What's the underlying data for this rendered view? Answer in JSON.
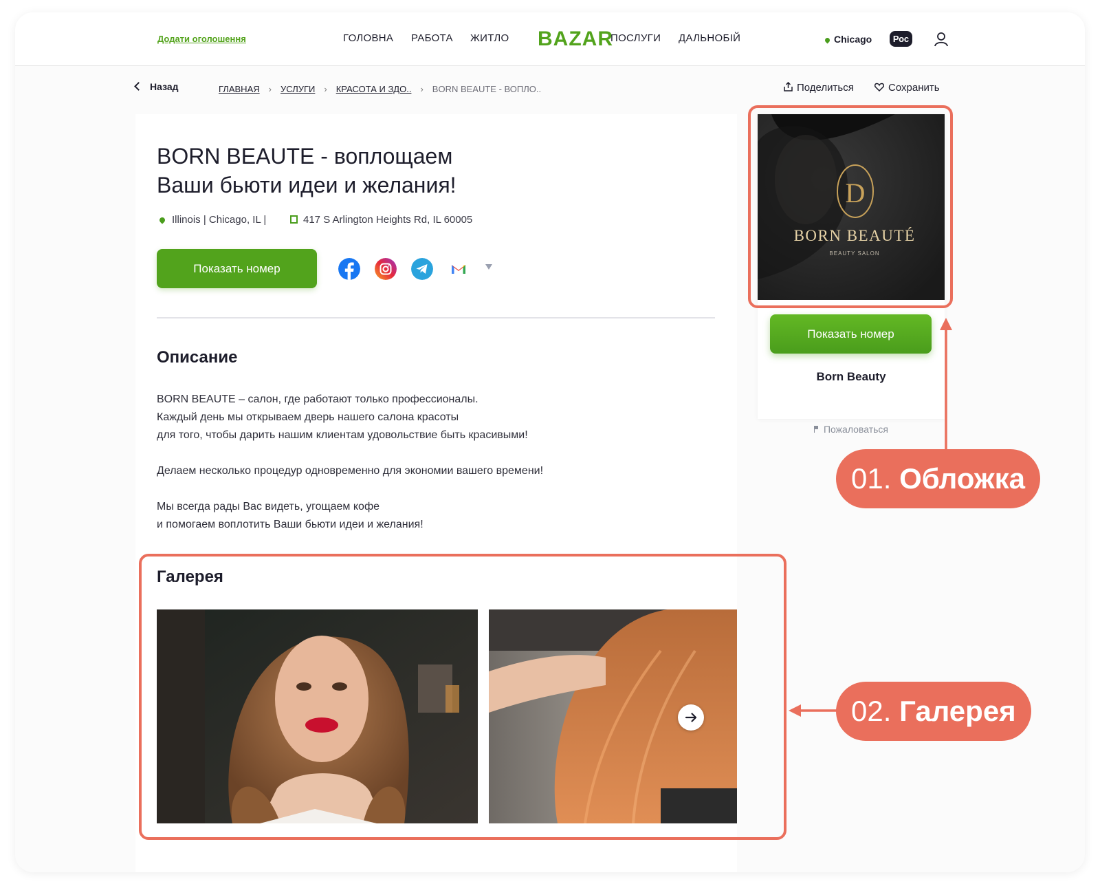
{
  "header": {
    "add_ad": "Додати оголошення",
    "nav": [
      "ГОЛОВНА",
      "РАБОТА",
      "ЖИТЛО",
      "ПОСЛУГИ",
      "ДАЛЬНОБІЙ"
    ],
    "logo": "BAZAR",
    "city": "Chicago",
    "lang": "Рос"
  },
  "breadcrumbs": {
    "back": "Назад",
    "items": [
      "ГЛАВНАЯ",
      "УСЛУГИ",
      "КРАСОТА И ЗДО.."
    ],
    "current": "BORN BEAUTE - ВОПЛО..",
    "share": "Поделиться",
    "save": "Сохранить"
  },
  "listing": {
    "title_line1": "BORN BEAUTE - воплощаем",
    "title_line2": "Ваши бьюти идеи и желания!",
    "location": "Illinois | Chicago, IL |",
    "address": "417 S Arlington Heights Rd, IL 60005",
    "show_phone": "Показать номер",
    "social": [
      "facebook-icon",
      "instagram-icon",
      "telegram-icon",
      "gmail-icon"
    ],
    "description_title": "Описание",
    "description": [
      "BORN BEAUTE – салон, где работают только профессионалы.",
      "Каждый день мы открываем дверь нашего салона красоты",
      "для того, чтобы дарить нашим клиентам удовольствие быть красивыми!",
      "Делаем несколько процедур одновременно для экономии вашего времени!",
      "Мы всегда рады Вас видеть, угощаем кофе",
      "и помогаем воплотить Ваши бьюти идеи и желания!"
    ],
    "gallery_title": "Галерея"
  },
  "sidebar": {
    "cover_brand": "BORN BEAUTÉ",
    "cover_sub": "BEAUTY SALON",
    "show_phone": "Показать номер",
    "seller": "Born Beauty",
    "report": "Пожаловаться"
  },
  "annotations": {
    "a1_num": "01.",
    "a1_label": "Обложка",
    "a2_num": "02.",
    "a2_label": "Галерея"
  },
  "colors": {
    "brand_green": "#52a31c",
    "annotation": "#ea6f5c",
    "text": "#1d1d2b"
  }
}
